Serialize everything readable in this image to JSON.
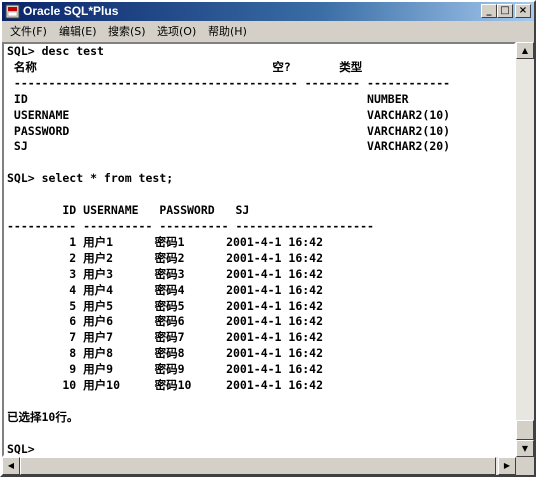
{
  "window": {
    "title": "Oracle SQL*Plus",
    "controls": {
      "minimize": "_",
      "maximize": "□",
      "close": "×"
    }
  },
  "menu": [
    {
      "label": "文件(F)"
    },
    {
      "label": "编辑(E)"
    },
    {
      "label": "搜索(S)"
    },
    {
      "label": "选项(O)"
    },
    {
      "label": "帮助(H)"
    }
  ],
  "console": {
    "lines": [
      "SQL> desc test",
      " 名称                                  空?       类型",
      " ----------------------------------------- -------- ------------",
      " ID                                                 NUMBER",
      " USERNAME                                           VARCHAR2(10)",
      " PASSWORD                                           VARCHAR2(10)",
      " SJ                                                 VARCHAR2(20)",
      "",
      "SQL> select * from test;",
      "",
      "        ID USERNAME   PASSWORD   SJ",
      "---------- ---------- ---------- --------------------",
      "         1 用户1      密码1      2001-4-1 16:42",
      "         2 用户2      密码2      2001-4-1 16:42",
      "         3 用户3      密码3      2001-4-1 16:42",
      "         4 用户4      密码4      2001-4-1 16:42",
      "         5 用户5      密码5      2001-4-1 16:42",
      "         6 用户6      密码6      2001-4-1 16:42",
      "         7 用户7      密码7      2001-4-1 16:42",
      "         8 用户8      密码8      2001-4-1 16:42",
      "         9 用户9      密码9      2001-4-1 16:42",
      "        10 用户10     密码10     2001-4-1 16:42",
      "",
      "已选择10行。",
      "",
      "SQL>"
    ]
  },
  "icons": {
    "app": "oracle-app-icon",
    "scroll_up": "▲",
    "scroll_down": "▼",
    "scroll_left": "◀",
    "scroll_right": "▶"
  },
  "colors": {
    "titlebar_start": "#0a246a",
    "titlebar_end": "#a6caf0",
    "chrome": "#d4d0c8",
    "console_bg": "#ffffff"
  }
}
